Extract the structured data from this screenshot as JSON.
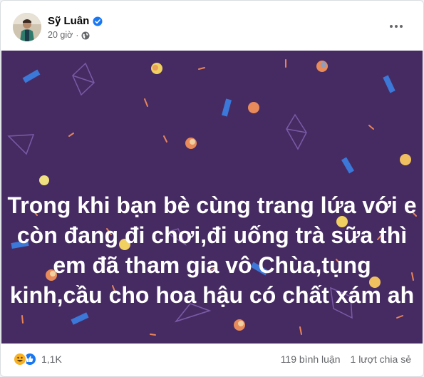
{
  "post": {
    "author_name": "Sỹ Luân",
    "time": "20 giờ",
    "separator": "·",
    "text_lines": [
      "Trong khi bạn bè cùng trang lứa với e",
      "còn đang đi chơi,đi uống trà sữa thì",
      "em đã tham gia vô Chùa,tụng",
      "kinh,cầu cho hoa hậu có chất xám ah"
    ],
    "background_color": "#462b63"
  },
  "footer": {
    "reaction_count": "1,1K",
    "comments": "119 bình luận",
    "shares": "1 lượt chia sẻ"
  },
  "icons": {
    "verified": "verified-badge-icon",
    "audience": "globe-icon",
    "more": "more-options-icon",
    "reactions": [
      "haha-reaction-icon",
      "like-reaction-icon"
    ]
  },
  "colors": {
    "verified": "#1877f2",
    "text_secondary": "#65676b",
    "haha": "#f7b125",
    "like": "#1877f2"
  }
}
